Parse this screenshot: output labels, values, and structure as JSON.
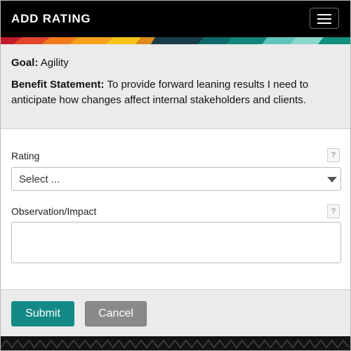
{
  "header": {
    "title": "ADD RATING",
    "menu_icon": "hamburger-menu-icon"
  },
  "info": {
    "goal_label": "Goal:",
    "goal_value": "Agility",
    "benefit_label": "Benefit Statement:",
    "benefit_value": "To provide forward leaning results I need to anticipate how changes affect internal stakeholders and clients."
  },
  "form": {
    "rating_label": "Rating",
    "rating_help": "?",
    "rating_selected": "Select ...",
    "observation_label": "Observation/Impact",
    "observation_help": "?",
    "observation_value": ""
  },
  "footer": {
    "submit_label": "Submit",
    "cancel_label": "Cancel"
  },
  "colors": {
    "header_bg": "#000000",
    "submit_bg": "#138a85",
    "cancel_bg": "#8a8a8a",
    "panel_bg": "#ebebeb"
  }
}
